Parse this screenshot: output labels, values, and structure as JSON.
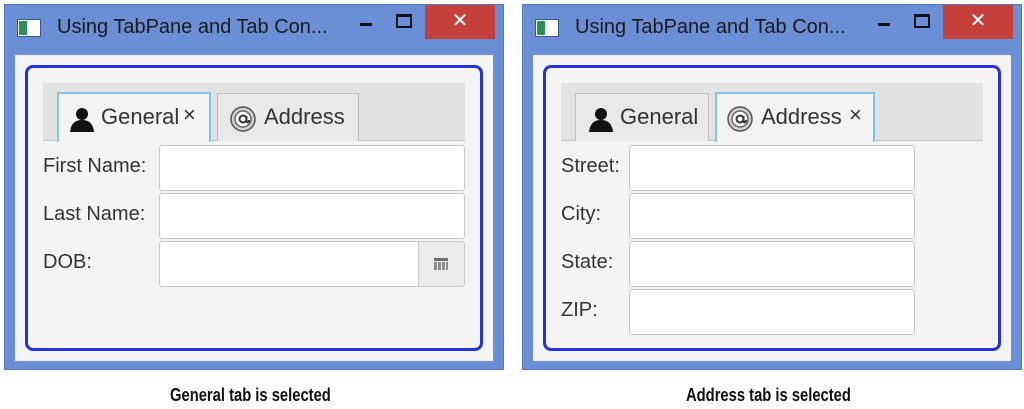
{
  "windows": {
    "general": {
      "title": "Using TabPane and Tab Con...",
      "tabs": [
        {
          "label": "General",
          "close": "×",
          "icon": "person-icon",
          "selected": true
        },
        {
          "label": "Address",
          "icon": "at-sign-icon",
          "selected": false
        }
      ],
      "fields": [
        {
          "label": "First Name:",
          "value": ""
        },
        {
          "label": "Last Name:",
          "value": ""
        },
        {
          "label": "DOB:",
          "value": "",
          "icon": "calendar-icon"
        }
      ]
    },
    "address": {
      "title": "Using TabPane and Tab Con...",
      "tabs": [
        {
          "label": "General",
          "icon": "person-icon",
          "selected": false
        },
        {
          "label": "Address",
          "close": "×",
          "icon": "at-sign-icon",
          "selected": true
        }
      ],
      "fields": [
        {
          "label": "Street:",
          "value": ""
        },
        {
          "label": "City:",
          "value": ""
        },
        {
          "label": "State:",
          "value": ""
        },
        {
          "label": "ZIP:",
          "value": ""
        }
      ]
    }
  },
  "window_controls": {
    "close_glyph": "✕"
  },
  "captions": {
    "left": "General tab is selected",
    "right": "Address tab is selected"
  },
  "colors": {
    "titlebar": "#6b8fd6",
    "close_button": "#c6403b",
    "focus_border": "#2233dd",
    "selected_tab_border": "#7fc3e6"
  }
}
